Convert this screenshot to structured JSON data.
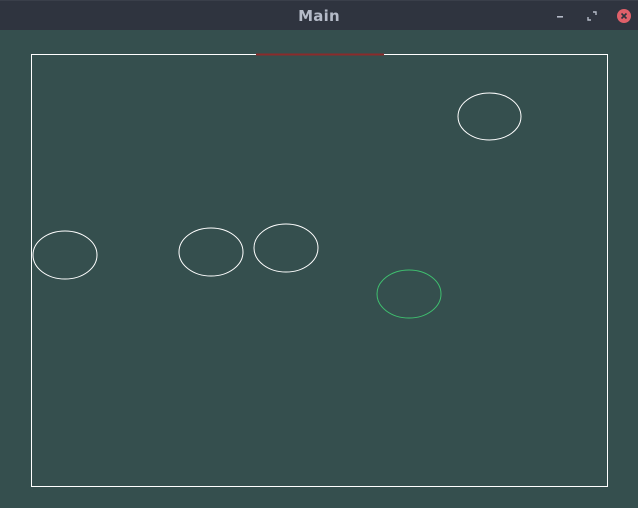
{
  "window": {
    "title": "Main"
  },
  "controls": {
    "minimize_icon": "minimize-icon",
    "restore_icon": "restore-icon",
    "close_icon": "close-icon"
  },
  "colors": {
    "background": "#354f4e",
    "titlebar": "#2f343f",
    "title_text": "#b5bbc8",
    "close_button": "#e0606a",
    "arena_border": "#ffffff",
    "paddle": "#8b2b2b",
    "ball_default": "#ffffff",
    "ball_highlight": "#3fbf6f"
  },
  "game": {
    "balls": [
      {
        "id": "ball-1",
        "state": "default"
      },
      {
        "id": "ball-2",
        "state": "default"
      },
      {
        "id": "ball-3",
        "state": "default"
      },
      {
        "id": "ball-4",
        "state": "default"
      },
      {
        "id": "ball-5",
        "state": "highlight"
      }
    ]
  }
}
